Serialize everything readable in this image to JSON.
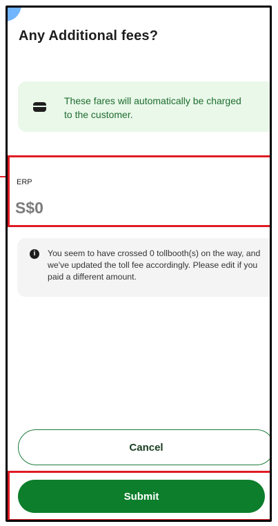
{
  "header": {
    "title": "Any Additional fees?"
  },
  "notice": {
    "text": "These fares will automatically be charged to the customer."
  },
  "erp": {
    "label": "ERP",
    "value": "S$0"
  },
  "toll_info": {
    "text": "You seem to have crossed 0 tollbooth(s) on the way, and we've updated the toll fee accordingly. Please edit if you paid a different amount."
  },
  "actions": {
    "cancel_label": "Cancel",
    "submit_label": "Submit"
  },
  "colors": {
    "accent_green": "#0d7e2b",
    "notice_bg": "#e9f8e9",
    "highlight_red": "#e01b24"
  },
  "icons": {
    "notice": "card-icon",
    "info": "info-icon"
  }
}
